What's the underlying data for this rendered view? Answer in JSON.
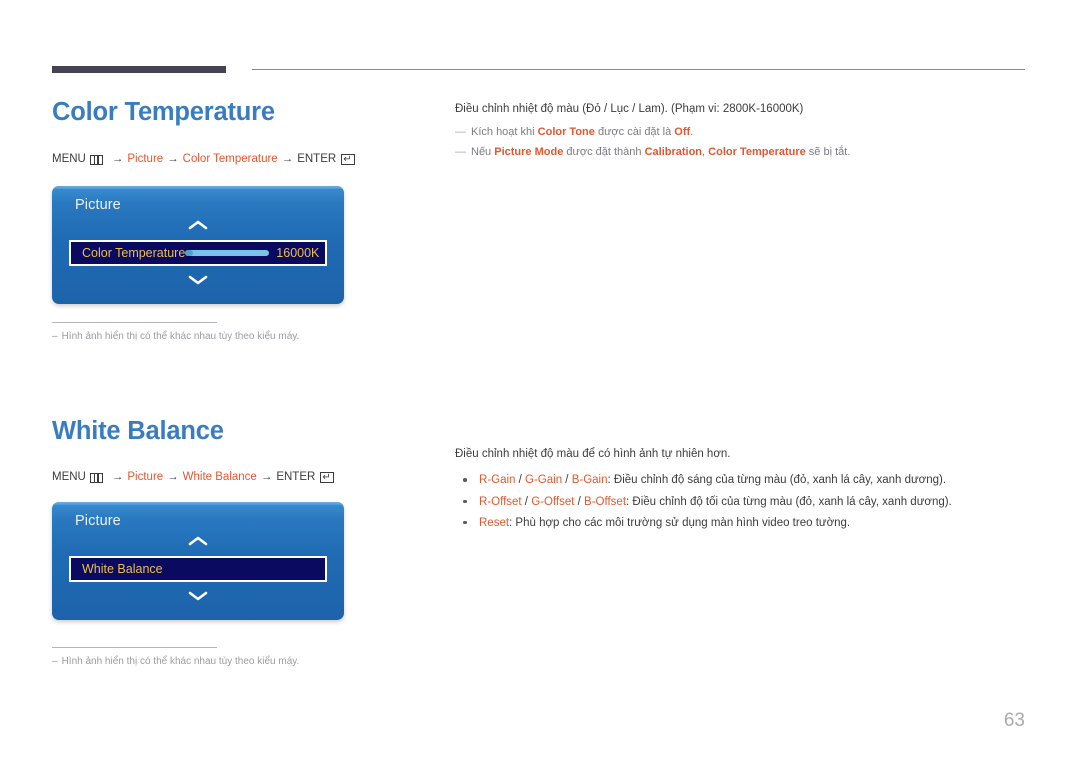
{
  "page": {
    "number": "63"
  },
  "icons": {
    "menu": "menu-grid-icon",
    "enter": "enter-return-icon",
    "chevron_up": "chevron-up-icon",
    "chevron_down": "chevron-down-icon",
    "arrow": "→"
  },
  "colors": {
    "heading_blue": "#3a7cc0",
    "accent_orange": "#e2572f",
    "osd_blue": "#1f6bb4",
    "osd_row_navy": "#0a0a60",
    "osd_row_text": "#e8c04a",
    "rule_dark": "#454351",
    "muted_gray": "#9b9ba3"
  },
  "sections": [
    {
      "id": "color-temperature",
      "heading": "Color Temperature",
      "menu_path": {
        "menu_label": "MENU",
        "arrow": "→",
        "items": [
          "Picture",
          "Color Temperature"
        ],
        "enter_label": "ENTER"
      },
      "osd": {
        "title": "Picture",
        "row_label": "Color Temperature",
        "row_value": "16000K",
        "has_slider": true
      },
      "footnote": {
        "dash": "–",
        "text": "Hình ảnh hiển thị có thể khác nhau tùy theo kiểu máy."
      },
      "right": {
        "lead": "Điều chỉnh nhiệt độ màu (Đỏ / Lục / Lam). (Phạm vi: 2800K-16000K)",
        "notes": [
          {
            "dash": "—",
            "parts": [
              {
                "t": "Kích hoạt khi ",
                "style": "plain"
              },
              {
                "t": "Color Tone",
                "style": "bold-accent"
              },
              {
                "t": " được cài đặt là ",
                "style": "plain"
              },
              {
                "t": "Off",
                "style": "bold-accent"
              },
              {
                "t": ".",
                "style": "plain"
              }
            ]
          },
          {
            "dash": "—",
            "parts": [
              {
                "t": "Nếu ",
                "style": "plain"
              },
              {
                "t": "Picture Mode",
                "style": "bold-accent"
              },
              {
                "t": " được đặt thành ",
                "style": "plain"
              },
              {
                "t": "Calibration",
                "style": "bold-accent"
              },
              {
                "t": ", ",
                "style": "plain"
              },
              {
                "t": "Color Temperature",
                "style": "bold-accent"
              },
              {
                "t": " sẽ bị tắt.",
                "style": "plain"
              }
            ]
          }
        ],
        "bullets": []
      }
    },
    {
      "id": "white-balance",
      "heading": "White Balance",
      "menu_path": {
        "menu_label": "MENU",
        "arrow": "→",
        "items": [
          "Picture",
          "White Balance"
        ],
        "enter_label": "ENTER"
      },
      "osd": {
        "title": "Picture",
        "row_label": "White Balance",
        "row_value": "",
        "has_slider": false
      },
      "footnote": {
        "dash": "–",
        "text": "Hình ảnh hiển thị có thể khác nhau tùy theo kiểu máy."
      },
      "right": {
        "lead": "Điều chỉnh nhiệt độ màu để có hình ảnh tự nhiên hơn.",
        "notes": [],
        "bullets": [
          {
            "keys": [
              "R-Gain",
              "G-Gain",
              "B-Gain"
            ],
            "separator": " / ",
            "desc": ": Điều chỉnh độ sáng của từng màu (đỏ, xanh lá cây, xanh dương)."
          },
          {
            "keys": [
              "R-Offset",
              "G-Offset",
              "B-Offset"
            ],
            "separator": " / ",
            "desc": ": Điều chỉnh độ tối của từng màu (đỏ, xanh lá cây, xanh dương)."
          },
          {
            "keys": [
              "Reset"
            ],
            "separator": " / ",
            "desc": ": Phù hợp cho các môi trường sử dụng màn hình video treo tường."
          }
        ]
      }
    }
  ]
}
